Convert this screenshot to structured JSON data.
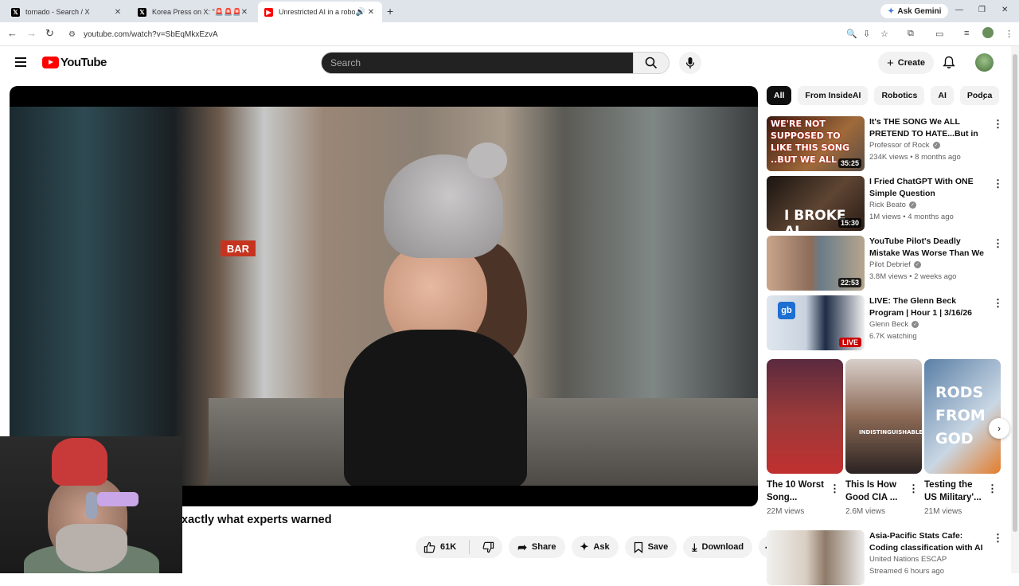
{
  "browser": {
    "tabs": [
      {
        "label": "tornado - Search / X",
        "icon": "x-logo-icon"
      },
      {
        "label": "Korea Press on X: \"🚨🚨🚨 Tr",
        "icon": "x-logo-icon"
      },
      {
        "label": "Unrestricted AI in a robot d",
        "icon": "youtube-icon"
      }
    ],
    "ask_gemini": "Ask Gemini",
    "url": "youtube.com/watch?v=SbEqMkxEzvA"
  },
  "youtube": {
    "logo_text": "YouTube",
    "search_placeholder": "Search",
    "create_label": "Create"
  },
  "video": {
    "title_visible": "xactly what experts warned",
    "likes": "61K",
    "share": "Share",
    "ask": "Ask",
    "save": "Save",
    "download": "Download",
    "frame_sign": "BAR"
  },
  "chips": [
    "All",
    "From InsideAI",
    "Robotics",
    "AI",
    "Podca"
  ],
  "recommendations": [
    {
      "title": "It's THE SONG We ALL PRETEND TO HATE...But in ...",
      "channel": "Professor of Rock",
      "meta": "234K views • 8 months ago",
      "duration": "35:25",
      "thumb_text": "WE'RE NOT SUPPOSED TO LIKE THIS SONG ..BUT WE ALL",
      "verified": true
    },
    {
      "title": "I Fried ChatGPT With ONE Simple Question",
      "channel": "Rick Beato",
      "meta": "1M views • 4 months ago",
      "duration": "15:30",
      "thumb_text": "I BROKE AI",
      "verified": true
    },
    {
      "title": "YouTube Pilot's Deadly Mistake Was Worse Than We Thought!",
      "channel": "Pilot Debrief",
      "meta": "3.8M views • 2 weeks ago",
      "duration": "22:53",
      "verified": true
    },
    {
      "title": "LIVE: The Glenn Beck Program | Hour 1 | 3/16/26",
      "channel": "Glenn Beck",
      "meta": "6.7K watching",
      "live": "LIVE",
      "thumb_text": "gb",
      "verified": true
    },
    {
      "title": "Asia-Pacific Stats Cafe: Coding classification with AI",
      "channel": "United Nations ESCAP",
      "meta": "Streamed 6 hours ago"
    }
  ],
  "shorts": [
    {
      "title": "The 10 Worst Song...",
      "views": "22M views"
    },
    {
      "title": "This Is How Good CIA ...",
      "views": "2.6M views",
      "thumb_text": "INDISTINGUISHABLE"
    },
    {
      "title": "Testing the US Military'...",
      "views": "21M views",
      "thumb_text": "RODS FROM GOD"
    }
  ],
  "colors": {
    "brand_red": "#ff0000",
    "live_red": "#cc0000",
    "chip_active": "#0f0f0f"
  }
}
